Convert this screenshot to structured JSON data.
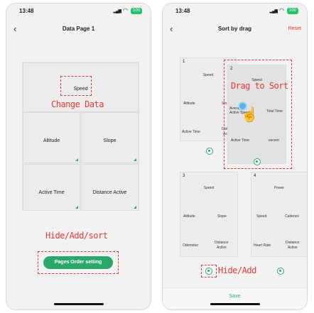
{
  "status": {
    "time": "13:48",
    "battery": "100"
  },
  "left": {
    "title": "Data Page 1",
    "tiles": {
      "speed": "Speed",
      "altitude": "Altitude",
      "slope": "Slope",
      "active_time": "Active Time",
      "distance_active": "Distance Active"
    },
    "annotation_change": "Change Data",
    "annotation_hide": "Hide/Add/sort",
    "button": "Pages Order setting"
  },
  "right": {
    "title": "Sort by drag",
    "reset": "Reset",
    "card1": {
      "num": "1",
      "speed": "Speed",
      "altitude": "Altitude",
      "slope": "Slo",
      "active_time": "Active Time",
      "dista": "Dista",
      "activ": "Activ"
    },
    "card2": {
      "num": "2",
      "speed": "Speed",
      "avg1": "Average",
      "avg2": "Active Speed",
      "total_time": "Total Time",
      "active_time_descent": "Active Time",
      "descent": "escent"
    },
    "card3": {
      "num": "3",
      "speed": "Speed",
      "altitude": "Altitude",
      "slope": "Slope",
      "odometer": "Odometer",
      "dist1": "Distance",
      "dist2": "Active"
    },
    "card4": {
      "num": "4",
      "power": "Power",
      "speed": "Speed",
      "cadence": "Cadence",
      "heart_rate": "Heart Rate",
      "dist1": "Distance",
      "dist2": "Active"
    },
    "annotation_drag": "Drag to Sort",
    "annotation_hide": "Hide/Add",
    "save": "Save"
  },
  "colors": {
    "accent": "#2aa86a",
    "annotation": "#e53935"
  }
}
